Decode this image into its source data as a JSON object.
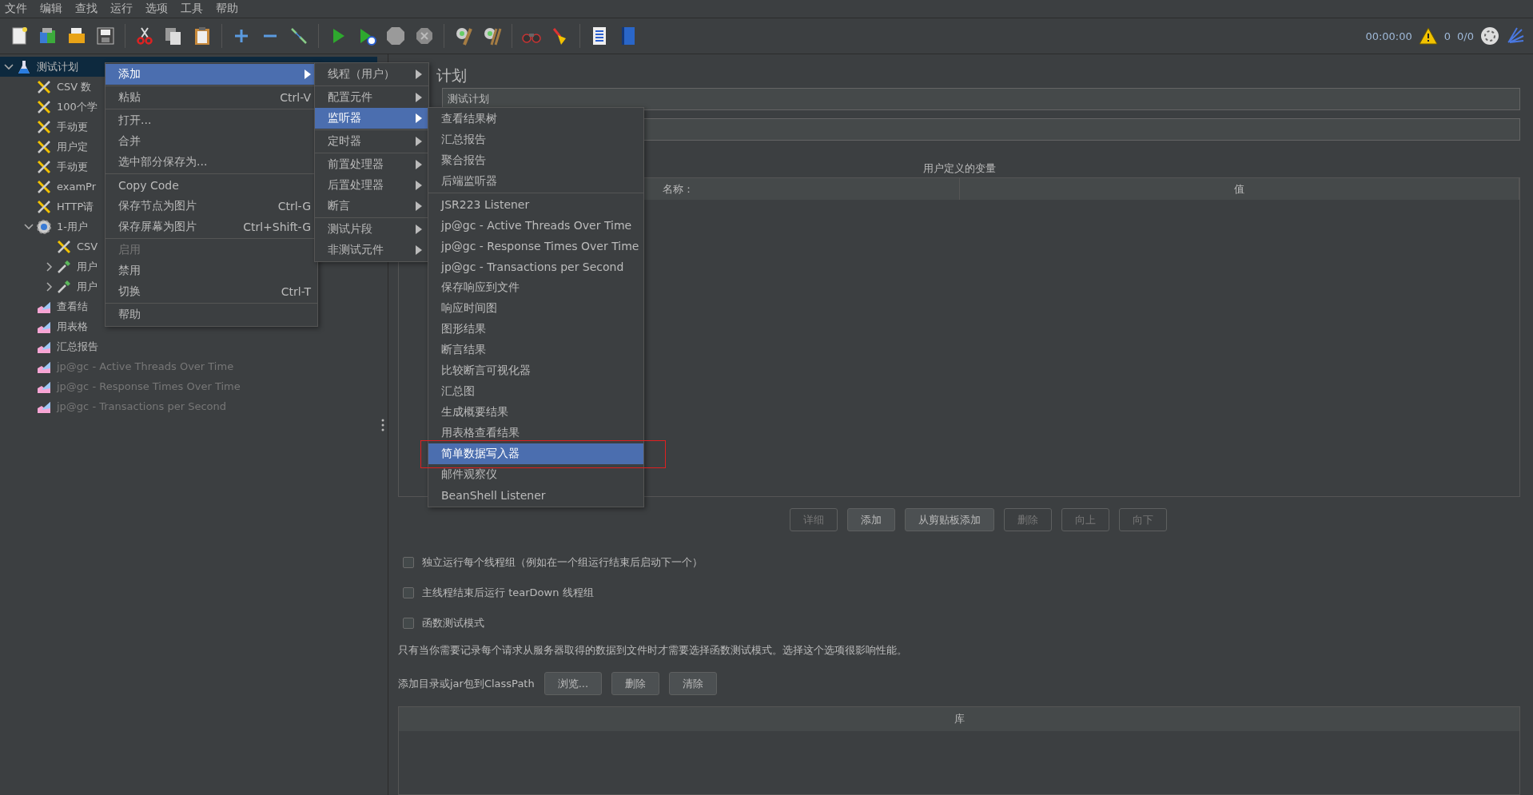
{
  "menubar": [
    "文件",
    "编辑",
    "查找",
    "运行",
    "选项",
    "工具",
    "帮助"
  ],
  "status": {
    "time": "00:00:00",
    "warnings": "0",
    "threads": "0/0"
  },
  "tree": [
    {
      "label": "测试计划",
      "kind": "plan",
      "selected": true,
      "expanded": true,
      "children": [
        {
          "label": "CSV 数",
          "kind": "config",
          "selected": false
        },
        {
          "label": "100个学",
          "kind": "config",
          "selected": false
        },
        {
          "label": "手动更",
          "kind": "config",
          "selected": false
        },
        {
          "label": "用户定",
          "kind": "config",
          "selected": false
        },
        {
          "label": "手动更",
          "kind": "config",
          "selected": false
        },
        {
          "label": "examPr",
          "kind": "config",
          "selected": false
        },
        {
          "label": "HTTP请",
          "kind": "config",
          "selected": false
        },
        {
          "label": "1-用户",
          "kind": "threads",
          "selected": false,
          "expanded": true,
          "children": [
            {
              "label": "CSV",
              "kind": "config",
              "selected": false
            },
            {
              "label": "用户",
              "kind": "sampler",
              "selected": false,
              "expanded": false
            },
            {
              "label": "用户",
              "kind": "sampler",
              "selected": false,
              "expanded": false
            }
          ]
        },
        {
          "label": "查看结",
          "kind": "listener",
          "selected": false
        },
        {
          "label": "用表格",
          "kind": "listener",
          "selected": false
        },
        {
          "label": "汇总报告",
          "kind": "listener",
          "selected": false
        },
        {
          "label": "jp@gc - Active Threads Over Time",
          "kind": "listener",
          "selected": false,
          "disabled": true
        },
        {
          "label": "jp@gc - Response Times Over Time",
          "kind": "listener",
          "selected": false,
          "disabled": true
        },
        {
          "label": "jp@gc - Transactions per Second",
          "kind": "listener",
          "selected": false,
          "disabled": true
        }
      ]
    }
  ],
  "heading": "计划",
  "name_field": {
    "value": "测试计划"
  },
  "variables": {
    "title": "用户定义的变量",
    "columns": [
      "名称：",
      "值"
    ]
  },
  "table_buttons": [
    {
      "label": "详细",
      "disabled": true
    },
    {
      "label": "添加",
      "disabled": false
    },
    {
      "label": "从剪贴板添加",
      "disabled": false
    },
    {
      "label": "删除",
      "disabled": true
    },
    {
      "label": "向上",
      "disabled": true
    },
    {
      "label": "向下",
      "disabled": true
    }
  ],
  "options": [
    {
      "label": "独立运行每个线程组（例如在一个组运行结束后启动下一个）",
      "checked": false
    },
    {
      "label": "主线程结束后运行 tearDown 线程组",
      "checked": false
    },
    {
      "label": "函数测试模式",
      "checked": false
    }
  ],
  "note": "只有当你需要记录每个请求从服务器取得的数据到文件时才需要选择函数测试模式。选择这个选项很影响性能。",
  "classpath": {
    "label": "添加目录或jar包到ClassPath",
    "buttons": [
      "浏览...",
      "删除",
      "清除"
    ],
    "column": "库"
  },
  "context_menu": [
    {
      "kind": "item",
      "label": "添加",
      "submenu": true,
      "selected": true
    },
    {
      "kind": "sep"
    },
    {
      "kind": "item",
      "label": "粘贴",
      "shortcut": "Ctrl-V",
      "selected": false
    },
    {
      "kind": "sep"
    },
    {
      "kind": "item",
      "label": "打开...",
      "selected": false
    },
    {
      "kind": "item",
      "label": "合并",
      "selected": false
    },
    {
      "kind": "item",
      "label": "选中部分保存为...",
      "selected": false
    },
    {
      "kind": "sep"
    },
    {
      "kind": "item",
      "label": "Copy Code",
      "selected": false
    },
    {
      "kind": "item",
      "label": "保存节点为图片",
      "shortcut": "Ctrl-G",
      "selected": false
    },
    {
      "kind": "item",
      "label": "保存屏幕为图片",
      "shortcut": "Ctrl+Shift-G",
      "selected": false
    },
    {
      "kind": "sep"
    },
    {
      "kind": "item",
      "label": "启用",
      "disabled": true,
      "selected": false
    },
    {
      "kind": "item",
      "label": "禁用",
      "selected": false
    },
    {
      "kind": "item",
      "label": "切换",
      "shortcut": "Ctrl-T",
      "selected": false
    },
    {
      "kind": "sep"
    },
    {
      "kind": "item",
      "label": "帮助",
      "selected": false
    }
  ],
  "add_menu": [
    {
      "kind": "item",
      "label": "线程（用户）",
      "submenu": true,
      "selected": false
    },
    {
      "kind": "sep"
    },
    {
      "kind": "item",
      "label": "配置元件",
      "submenu": true,
      "selected": false
    },
    {
      "kind": "item",
      "label": "监听器",
      "submenu": true,
      "selected": true
    },
    {
      "kind": "sep"
    },
    {
      "kind": "item",
      "label": "定时器",
      "submenu": true,
      "selected": false
    },
    {
      "kind": "sep"
    },
    {
      "kind": "item",
      "label": "前置处理器",
      "submenu": true,
      "selected": false
    },
    {
      "kind": "item",
      "label": "后置处理器",
      "submenu": true,
      "selected": false
    },
    {
      "kind": "item",
      "label": "断言",
      "submenu": true,
      "selected": false
    },
    {
      "kind": "sep"
    },
    {
      "kind": "item",
      "label": "测试片段",
      "submenu": true,
      "selected": false
    },
    {
      "kind": "item",
      "label": "非测试元件",
      "submenu": true,
      "selected": false
    }
  ],
  "listener_menu": [
    {
      "kind": "item",
      "label": "查看结果树",
      "selected": false
    },
    {
      "kind": "item",
      "label": "汇总报告",
      "selected": false
    },
    {
      "kind": "item",
      "label": "聚合报告",
      "selected": false
    },
    {
      "kind": "item",
      "label": "后端监听器",
      "selected": false
    },
    {
      "kind": "sep"
    },
    {
      "kind": "item",
      "label": "JSR223 Listener",
      "selected": false
    },
    {
      "kind": "item",
      "label": "jp@gc - Active Threads Over Time",
      "selected": false
    },
    {
      "kind": "item",
      "label": "jp@gc - Response Times Over Time",
      "selected": false
    },
    {
      "kind": "item",
      "label": "jp@gc - Transactions per Second",
      "selected": false
    },
    {
      "kind": "item",
      "label": "保存响应到文件",
      "selected": false
    },
    {
      "kind": "item",
      "label": "响应时间图",
      "selected": false
    },
    {
      "kind": "item",
      "label": "图形结果",
      "selected": false
    },
    {
      "kind": "item",
      "label": "断言结果",
      "selected": false
    },
    {
      "kind": "item",
      "label": "比较断言可视化器",
      "selected": false
    },
    {
      "kind": "item",
      "label": "汇总图",
      "selected": false
    },
    {
      "kind": "item",
      "label": "生成概要结果",
      "selected": false
    },
    {
      "kind": "item",
      "label": "用表格查看结果",
      "selected": false
    },
    {
      "kind": "item",
      "label": "简单数据写入器",
      "selected": true,
      "annotated": true
    },
    {
      "kind": "item",
      "label": "邮件观察仪",
      "selected": false
    },
    {
      "kind": "item",
      "label": "BeanShell Listener",
      "selected": false
    }
  ]
}
